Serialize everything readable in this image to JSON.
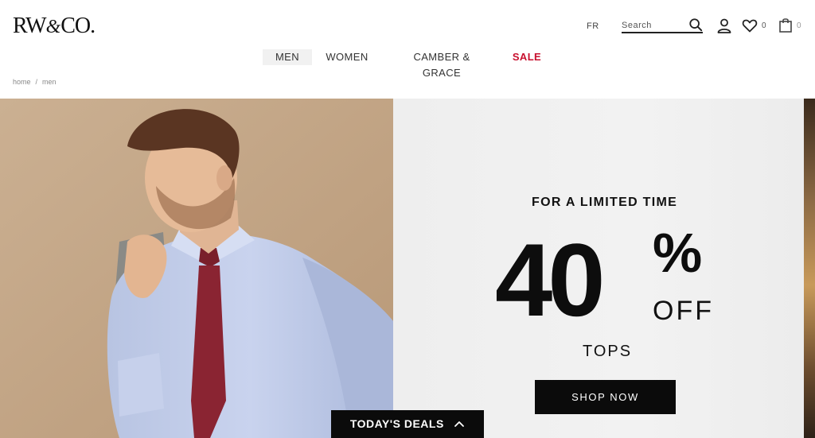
{
  "header": {
    "logo": {
      "text_main": "RW",
      "text_amp": "&",
      "text_end": "CO."
    },
    "language": "FR",
    "search": {
      "placeholder": "Search",
      "icon": "search-icon"
    },
    "account_icon": "user-icon",
    "wishlist": {
      "icon": "heart-icon",
      "count": "0"
    },
    "bag": {
      "icon": "shopping-bag-icon",
      "count": "0"
    }
  },
  "nav": {
    "items": [
      {
        "label": "MEN",
        "active": true
      },
      {
        "label": "WOMEN"
      },
      {
        "label": "CAMBER & GRACE"
      },
      {
        "label": "SALE",
        "color": "#c8102e"
      }
    ]
  },
  "breadcrumb": {
    "items": [
      "home",
      "men"
    ],
    "separator": "/"
  },
  "hero": {
    "eyebrow": "FOR A LIMITED TIME",
    "amount": "40",
    "percent": "%",
    "off": "OFF",
    "category": "TOPS",
    "cta": "SHOP NOW",
    "colors": {
      "left_bg": "#c4a688",
      "right_bg": "#efefef",
      "button": "#0b0b0b"
    }
  },
  "deals_bar": {
    "label": "TODAY'S DEALS",
    "icon": "chevron-up-icon"
  }
}
